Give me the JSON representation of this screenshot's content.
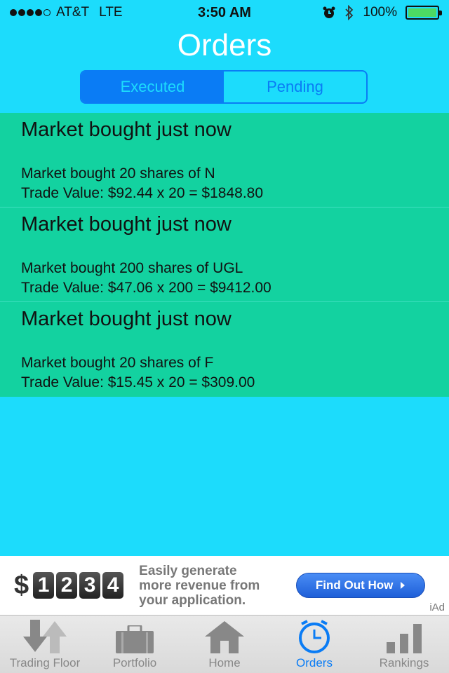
{
  "status": {
    "carrier": "AT&T",
    "network": "LTE",
    "time": "3:50 AM",
    "battery": "100%",
    "battery_level": 1.0
  },
  "header": {
    "title": "Orders",
    "tabs": [
      {
        "label": "Executed",
        "selected": true
      },
      {
        "label": "Pending",
        "selected": false
      }
    ]
  },
  "orders": [
    {
      "heading": "Market bought just now",
      "detail": "Market bought 20 shares of N",
      "value": "Trade Value: $92.44 x 20 = $1848.80"
    },
    {
      "heading": "Market bought just now",
      "detail": "Market bought 200 shares of UGL",
      "value": "Trade Value: $47.06 x 200 = $9412.00"
    },
    {
      "heading": "Market bought just now",
      "detail": "Market bought 20 shares of F",
      "value": "Trade Value: $15.45 x 20 = $309.00"
    }
  ],
  "ad": {
    "digits": [
      "1",
      "2",
      "3",
      "4"
    ],
    "dollar": "$",
    "text_line1": "Easily generate",
    "text_line2": "more revenue from",
    "text_line3": "your application.",
    "button": "Find Out How",
    "tag": "iAd"
  },
  "tabbar": {
    "items": [
      {
        "label": "Trading Floor",
        "icon": "arrows-icon"
      },
      {
        "label": "Portfolio",
        "icon": "briefcase-icon"
      },
      {
        "label": "Home",
        "icon": "home-icon"
      },
      {
        "label": "Orders",
        "icon": "clock-icon",
        "selected": true
      },
      {
        "label": "Rankings",
        "icon": "bar-chart-icon"
      }
    ]
  },
  "colors": {
    "background": "#1cdcfc",
    "order_bg": "#13d2a0",
    "accent": "#0a7cf5"
  }
}
